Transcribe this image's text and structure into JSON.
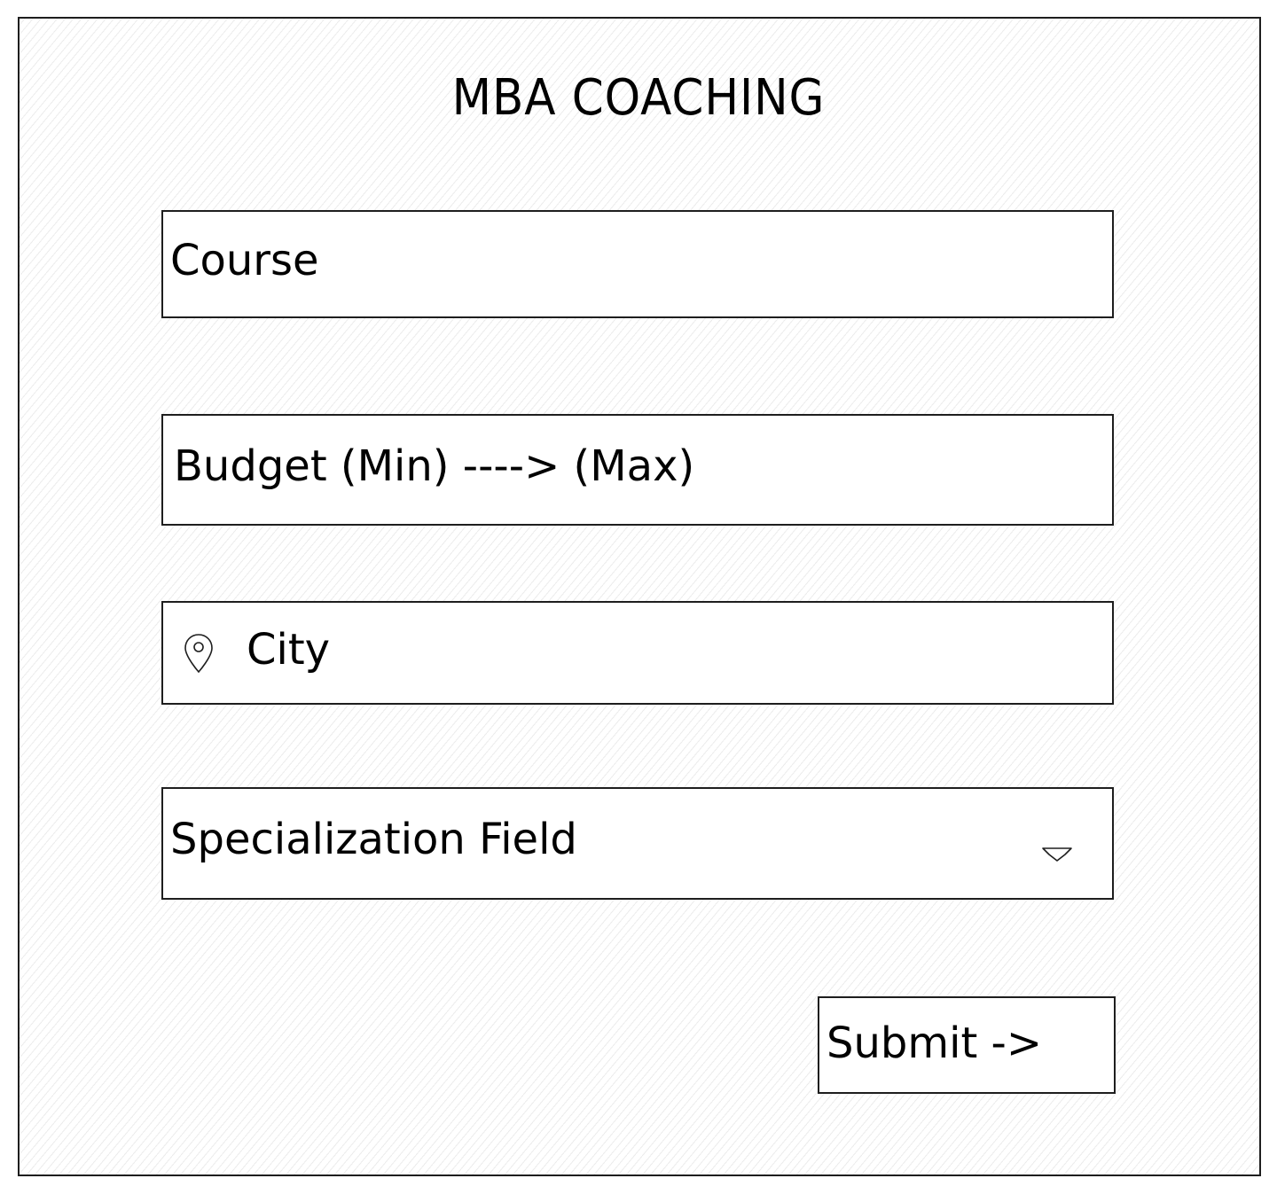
{
  "header": {
    "title": "MBA COACHING"
  },
  "form": {
    "course": {
      "placeholder": "Course",
      "value": ""
    },
    "budget": {
      "placeholder": "Budget (Min) ----> (Max)",
      "value": ""
    },
    "city": {
      "placeholder": "City",
      "value": "",
      "icon": "location-pin-icon"
    },
    "specialization": {
      "placeholder": "Specialization Field",
      "icon": "chevron-down-icon"
    },
    "submit_label": "Submit ->"
  },
  "colors": {
    "stroke": "#1e1e1e",
    "background": "#ffffff",
    "hatch": "#e6e6e6"
  }
}
